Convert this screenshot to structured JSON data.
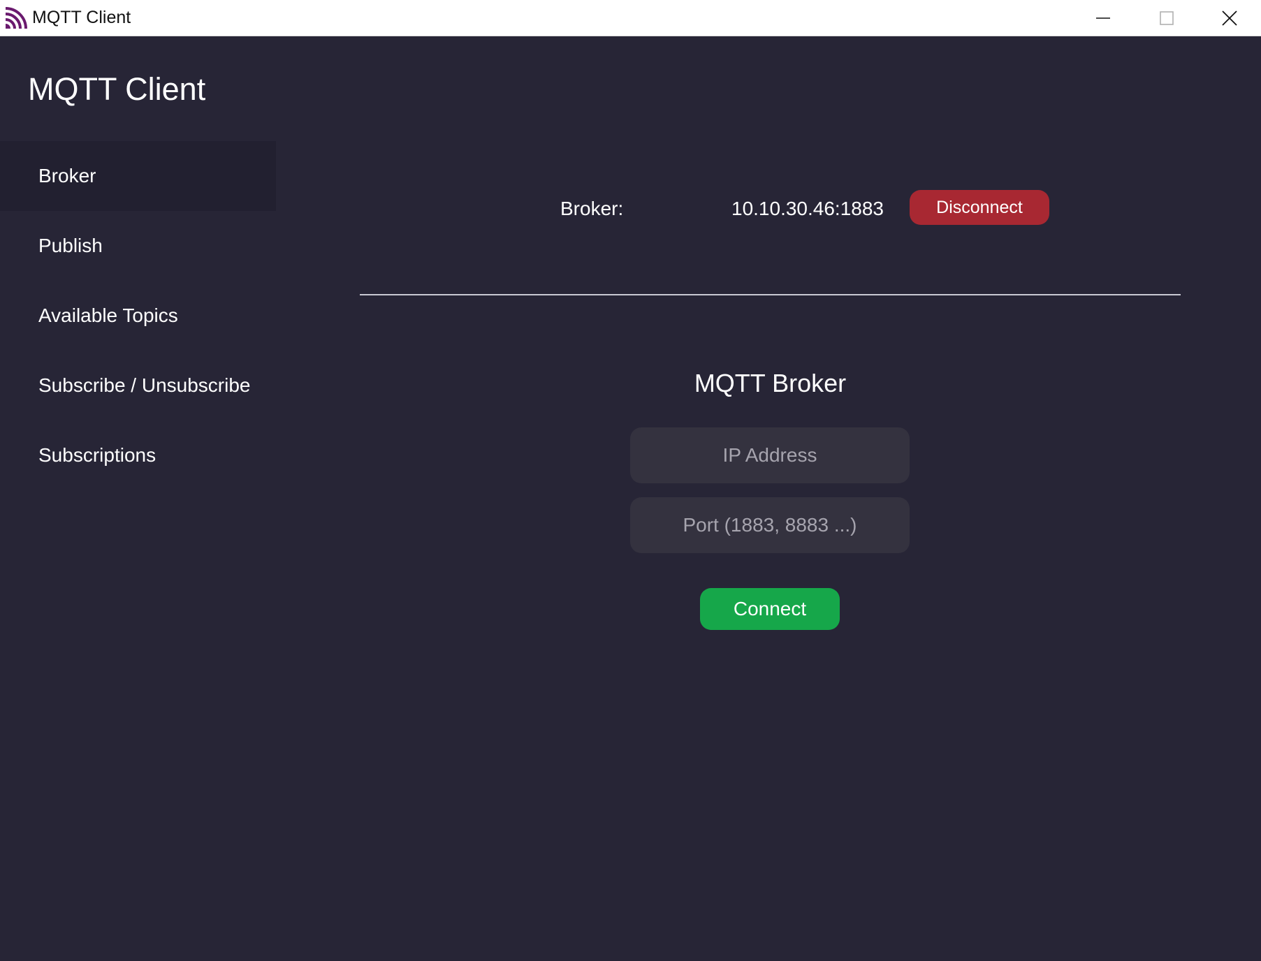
{
  "window": {
    "title": "MQTT Client",
    "controls": {
      "minimize": "minimize-icon",
      "maximize": "maximize-icon",
      "close": "close-icon"
    }
  },
  "app": {
    "title": "MQTT Client"
  },
  "sidebar": {
    "items": [
      {
        "label": "Broker",
        "active": true
      },
      {
        "label": "Publish",
        "active": false
      },
      {
        "label": "Available Topics",
        "active": false
      },
      {
        "label": "Subscribe / Unsubscribe",
        "active": false
      },
      {
        "label": "Subscriptions",
        "active": false
      }
    ]
  },
  "broker_status": {
    "label": "Broker:",
    "value": "10.10.30.46:1883",
    "disconnect_label": "Disconnect"
  },
  "connect_form": {
    "title": "MQTT Broker",
    "ip_placeholder": "IP Address",
    "port_placeholder": "Port (1883, 8883 ...)",
    "connect_label": "Connect"
  },
  "colors": {
    "background": "#272536",
    "sidebar_active": "#222030",
    "input_background": "#34323f",
    "disconnect": "#a82832",
    "connect": "#16a74a",
    "icon_accent": "#6a1a6e"
  }
}
